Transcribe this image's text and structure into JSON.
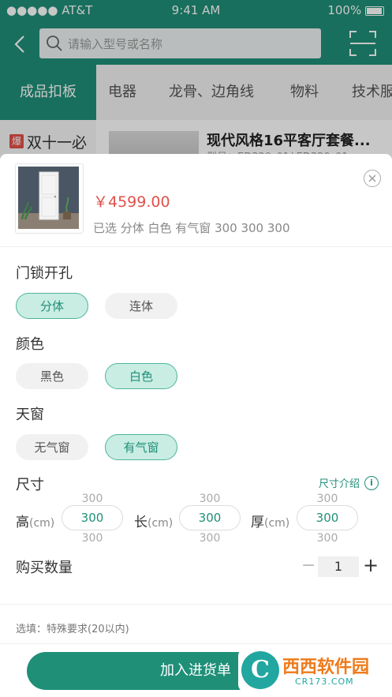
{
  "status_bar": {
    "carrier": "●●●●● AT&T",
    "time": "9:41 AM",
    "battery": "100%"
  },
  "search": {
    "placeholder": "请输入型号或名称"
  },
  "category_tabs": [
    "成品扣板",
    "电器",
    "龙骨、边角线",
    "物料",
    "技术服"
  ],
  "background_product": {
    "hot_tag": "爆",
    "promo_label": "双十一必",
    "title": "现代风格16平客厅套餐...",
    "subtitle": "型号：ED320_01/ ED320_01"
  },
  "sheet": {
    "price": "￥4599.00",
    "selected": "已选 分体 白色 有气窗 300 300 300",
    "options": [
      {
        "title": "门锁开孔",
        "choices": [
          "分体",
          "连体"
        ],
        "selected": "分体"
      },
      {
        "title": "颜色",
        "choices": [
          "黑色",
          "白色"
        ],
        "selected": "白色"
      },
      {
        "title": "天窗",
        "choices": [
          "无气窗",
          "有气窗"
        ],
        "selected": "有气窗"
      }
    ],
    "size": {
      "title": "尺寸",
      "guide_label": "尺寸介绍",
      "fields": [
        {
          "label": "高",
          "unit": "(cm)",
          "above": "300",
          "value": "300",
          "below": "300"
        },
        {
          "label": "长",
          "unit": "(cm)",
          "above": "300",
          "value": "300",
          "below": "300"
        },
        {
          "label": "厚",
          "unit": "(cm)",
          "above": "300",
          "value": "300",
          "below": "300"
        }
      ]
    },
    "quantity": {
      "title": "购买数量",
      "minus": "−",
      "value": "1",
      "plus": "+"
    },
    "note_label": "选填：特殊要求(20以内)",
    "add_button": "加入进货单"
  },
  "watermark": {
    "circle": "C",
    "text": "西西软件园",
    "url": "CR173.COM"
  },
  "colors": {
    "brand": "#1f8f78",
    "price": "#e0504a",
    "chip_selected_bg": "#c9ede3"
  }
}
